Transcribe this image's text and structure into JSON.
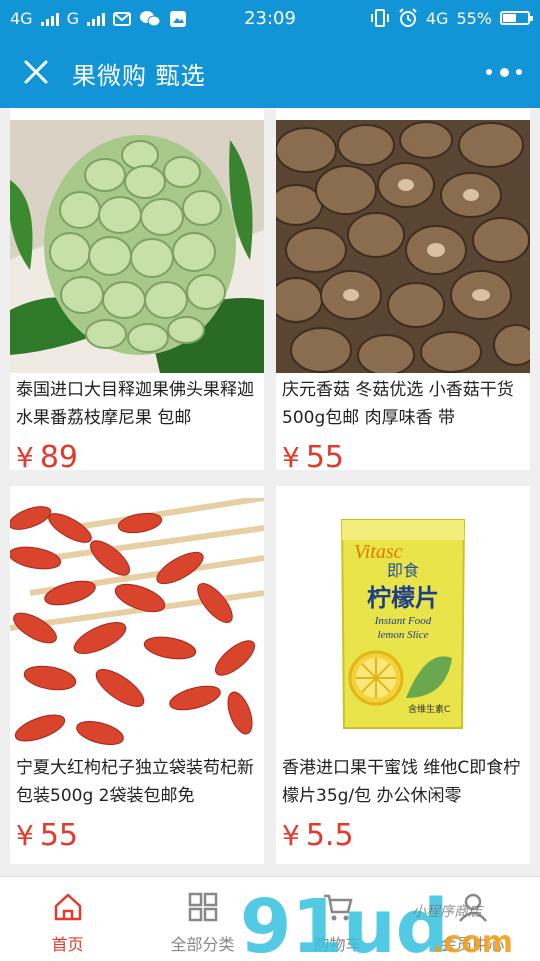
{
  "status_bar": {
    "network1": "4G",
    "network2": "G",
    "time": "23:09",
    "net_right": "4G",
    "battery": "55%",
    "battery_level": 0.55
  },
  "header": {
    "title": "果微购 甄选"
  },
  "products": [
    {
      "name": "泰国进口大目释迦果佛头果释迦水果番荔枝摩尼果 包邮",
      "currency": "¥",
      "price": "89"
    },
    {
      "name": "庆元香菇 冬菇优选 小香菇干货500g包邮 肉厚味香 带",
      "currency": "¥",
      "price": "55"
    },
    {
      "name": "宁夏大红枸杞子独立袋装苟杞新包装500g 2袋装包邮免",
      "currency": "¥",
      "price": "55"
    },
    {
      "name": "香港进口果干蜜饯 维他C即食柠檬片35g/包 办公休闲零",
      "currency": "¥",
      "price": "5.5"
    }
  ],
  "package": {
    "brand": "Vitasc",
    "title": "即食",
    "name": "柠檬片",
    "en1": "Instant Food",
    "en2": "lemon Slice",
    "note": "含维生素C"
  },
  "tabs": [
    {
      "label": "首页",
      "icon": "home-icon"
    },
    {
      "label": "全部分类",
      "icon": "grid-icon"
    },
    {
      "label": "购物车",
      "icon": "cart-icon"
    },
    {
      "label": "会员中心",
      "icon": "user-icon"
    }
  ],
  "watermark": {
    "text": "91ud",
    "suffix": ".com",
    "shop": "小程序商店"
  },
  "colors": {
    "primary": "#1195d6",
    "price": "#e43a2b"
  }
}
